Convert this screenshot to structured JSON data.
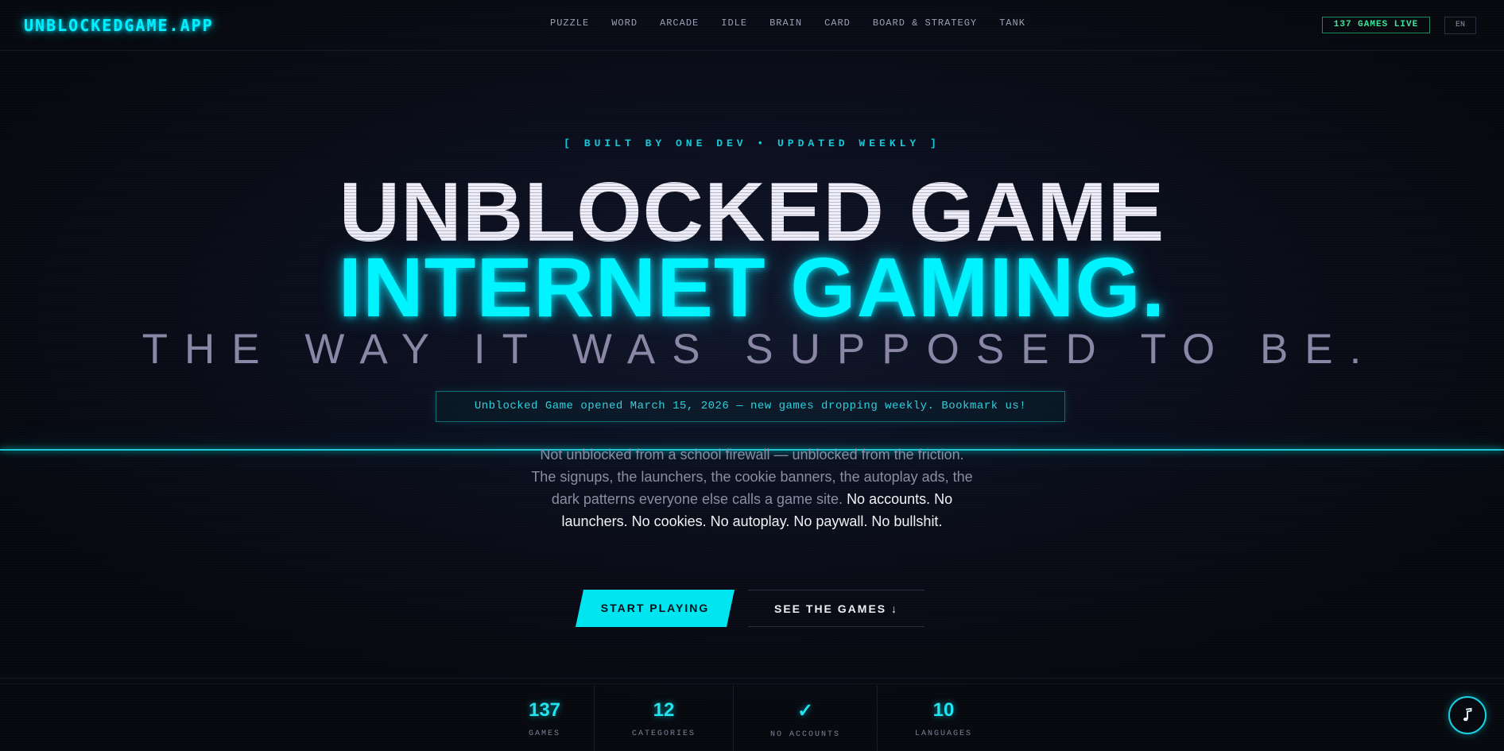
{
  "header": {
    "logo": "UNBLOCKEDGAME.APP",
    "nav": [
      "PUZZLE",
      "WORD",
      "ARCADE",
      "IDLE",
      "BRAIN",
      "CARD",
      "BOARD & STRATEGY",
      "TANK"
    ],
    "live_badge": "137 GAMES LIVE",
    "lang": "EN"
  },
  "hero": {
    "kicker": "[ BUILT BY ONE DEV • UPDATED WEEKLY ]",
    "title_line1": "UNBLOCKED GAME",
    "title_line2": "INTERNET GAMING.",
    "title_line3": "THE WAY IT WAS SUPPOSED TO BE.",
    "notice": "Unblocked Game opened March 15, 2026 — new games dropping weekly. Bookmark us!",
    "desc_plain": "Not unblocked from a school firewall — unblocked from the friction. The signups, the launchers, the cookie banners, the autoplay ads, the dark patterns everyone else calls a game site.",
    "desc_strong": "No accounts. No launchers. No cookies. No autoplay. No paywall. No bullshit.",
    "cta_primary": "START PLAYING",
    "cta_secondary": "SEE THE GAMES ↓"
  },
  "stats": [
    {
      "value": "137",
      "label": "GAMES"
    },
    {
      "value": "12",
      "label": "CATEGORIES"
    },
    {
      "value": "✓",
      "label": "NO ACCOUNTS"
    },
    {
      "value": "10",
      "label": "LANGUAGES"
    }
  ],
  "music_button_icon": "music-note-icon",
  "colors": {
    "accent": "#00f0ff",
    "background": "#080a14",
    "live_green": "#3ce89a"
  }
}
